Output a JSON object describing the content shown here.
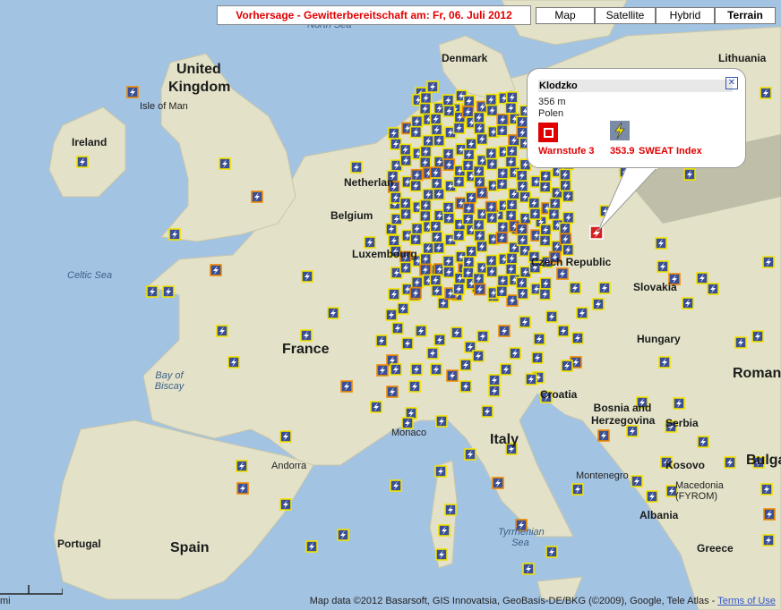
{
  "header": {
    "forecast_title": "Vorhersage - Gewitterbereitschaft am: Fr, 06. Juli 2012"
  },
  "map_types": [
    {
      "label": "Map",
      "active": false
    },
    {
      "label": "Satellite",
      "active": false
    },
    {
      "label": "Hybrid",
      "active": false
    },
    {
      "label": "Terrain",
      "active": true
    }
  ],
  "popup": {
    "station": "Klodzko",
    "elevation": "356 m",
    "country": "Polen",
    "close_icon": "close-icon",
    "warn_label": "Warnstufe 3",
    "sweat_value": "353.9",
    "sweat_label": "SWEAT Index",
    "warn_color": "#e00000"
  },
  "labels": {
    "countries": [
      "United Kingdom",
      "Ireland",
      "France",
      "Spain",
      "Portugal",
      "Italy",
      "Belgium",
      "Netherlan",
      "Luxembourg",
      "Czech Republic",
      "Slovakia",
      "Hungary",
      "Croatia",
      "Bosnia and Herzegovina",
      "Serbia",
      "Montenegro",
      "Albania",
      "Kosovo",
      "Macedonia (FYROM)",
      "Greece",
      "Romania",
      "Bulgaria",
      "Denmark",
      "Lithuania",
      "Andorra",
      "Monaco",
      "Isle of Man"
    ],
    "seas": [
      "North Sea",
      "Celtic Sea",
      "Bay of Biscay",
      "Tyrrhenian Sea"
    ]
  },
  "footer": {
    "attribution": "Map data ©2012 Basarsoft, GIS Innovatsia, GeoBasis-DE/BKG (©2009), Google, Tele Atlas -",
    "terms_link": "Terms of Use"
  },
  "scale": {
    "unit": "mi"
  },
  "colors": {
    "water": "#a3c3e3",
    "land": "#e3e2c9",
    "marker_border": "#f2e200",
    "marker_fill": "#3a4f96",
    "selected_marker": "#d42020"
  }
}
